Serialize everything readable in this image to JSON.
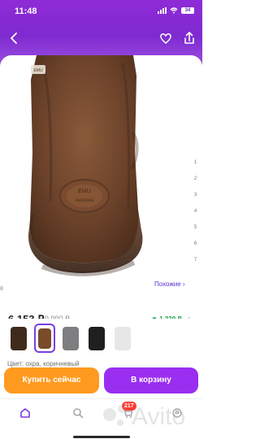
{
  "status": {
    "time": "11:48",
    "battery": "34"
  },
  "header": {
    "back_icon": "arrow-left-icon",
    "favorite_icon": "heart-icon",
    "share_icon": "share-icon"
  },
  "product": {
    "brand_tag": "EMU",
    "heel_logo_line1": "EMU",
    "heel_logo_line2": "Australia"
  },
  "gallery": {
    "pager": [
      "1",
      "2",
      "3",
      "4",
      "5",
      "6",
      "7"
    ],
    "similar_label": "Похожие ›",
    "left_number": "8"
  },
  "price": {
    "current": "6 153 ₽",
    "old": "9 990 ₽",
    "drop": "▼ 1 339 ₽",
    "chevron": "›"
  },
  "variants": [
    {
      "name": "dark-brown",
      "color": "#3f2b1e",
      "selected": false
    },
    {
      "name": "ochre-brown",
      "color": "#7a4a2b",
      "selected": true
    },
    {
      "name": "grey",
      "color": "#7e7e80",
      "selected": false
    },
    {
      "name": "black",
      "color": "#1f1f1f",
      "selected": false
    },
    {
      "name": "white",
      "color": "#e7e7e7",
      "selected": false
    }
  ],
  "color_line": "Цвет: охра, коричневый",
  "cta": {
    "buy_label": "Купить сейчас",
    "cart_label": "В корзину"
  },
  "tabbar": {
    "badge": "217"
  },
  "colors": {
    "accent": "#7b3de3",
    "buy": "#ff9a1f",
    "cart": "#9a2ef0",
    "drop": "#18a34a"
  },
  "watermark": "Avito"
}
